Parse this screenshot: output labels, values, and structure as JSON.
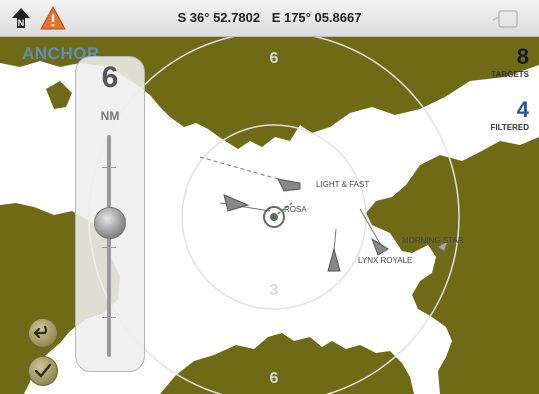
{
  "status_bar": {
    "latitude": "S 36° 52.7802",
    "longitude": "E 175° 05.8667",
    "north_icon": "north-up-icon",
    "warning_icon": "warning-icon",
    "screen_icon": "screen-toggle-icon"
  },
  "map": {
    "mode_label": "ANCHOR",
    "range_rings": {
      "inner": "3",
      "outer_top": "6",
      "outer_bottom": "6"
    },
    "vessel_labels": [
      "LIGHT & FAST",
      "ROSA",
      "MORNING STAR",
      "LYNX ROYALE"
    ],
    "land_color": "#6e6a16",
    "water_color": "#ffffff"
  },
  "stats": {
    "targets_count": "8",
    "targets_label": "TARGETS",
    "filtered_count": "4",
    "filtered_label": "FILTERED"
  },
  "range_panel": {
    "value": "6",
    "unit": "NM"
  },
  "buttons": {
    "undo_icon": "undo-icon",
    "accept_icon": "checkmark-icon"
  }
}
